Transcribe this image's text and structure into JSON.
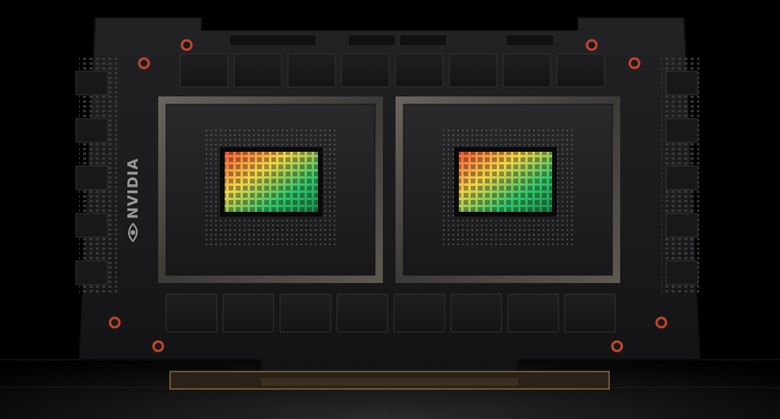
{
  "board": {
    "brand": "NVIDIA",
    "colors": {
      "background": "#000000",
      "pcb": "#1b1b1d",
      "pcb_edge": "#0e0e10",
      "chip_frame": "#5a5650",
      "die_glow_red": "#ff5a3c",
      "die_glow_yellow": "#f2d64a",
      "die_glow_green": "#31c46a",
      "mount_ring": "#c2452c",
      "gold_edge": "#8a6a3a"
    },
    "icons": [
      "nvidia-eye-logo-icon"
    ]
  }
}
